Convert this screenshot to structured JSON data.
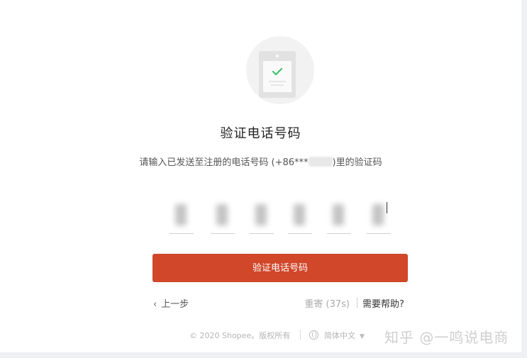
{
  "verify": {
    "title": "验证电话号码",
    "subtitle_prefix": "请输入已发送至注册的电话号码 (+86***",
    "subtitle_suffix": ")里的验证码",
    "submit_label": "验证电话号码",
    "back_label": "上一步",
    "resend_label": "重寄 (37s)",
    "help_label": "需要帮助?"
  },
  "otp": {
    "digit_count": 6
  },
  "footer": {
    "copyright": "© 2020 Shopee。版权所有",
    "language": "简体中文"
  },
  "watermark": "知乎 @一鸣说电商",
  "icons": [
    "verified-phone-illustration",
    "check-icon",
    "chevron-left-icon",
    "globe-icon",
    "caret-down-icon"
  ],
  "colors": {
    "accent": "#d0472a",
    "check": "#3cc16a"
  }
}
